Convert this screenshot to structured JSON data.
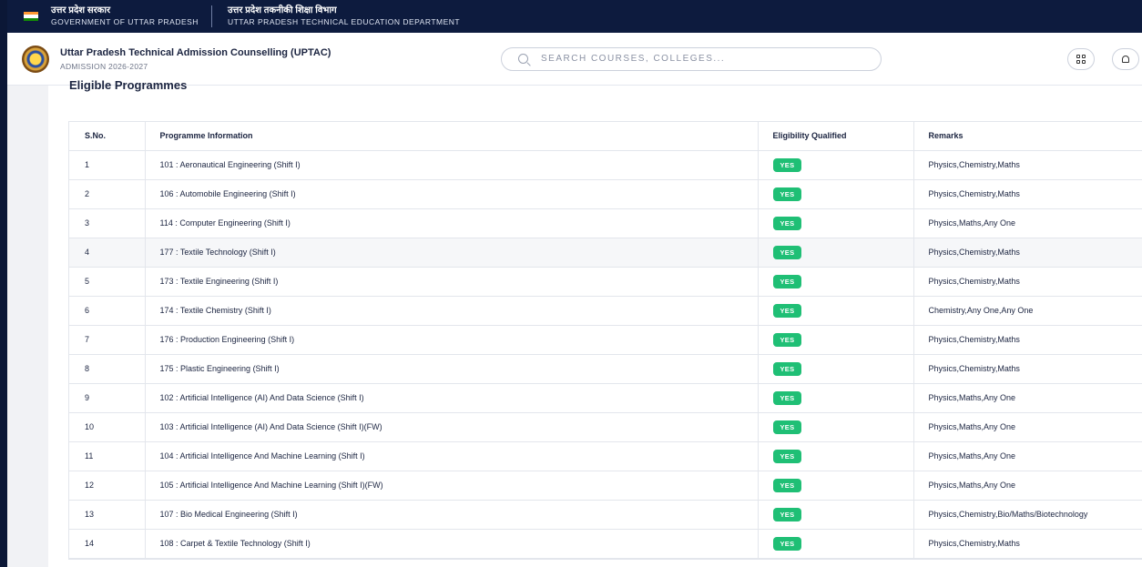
{
  "gov": {
    "hindi": "उत्तर प्रदेश सरकार",
    "english": "GOVERNMENT OF UTTAR PRADESH",
    "dept_hindi": "उत्तर प्रदेश तकनीकी शिक्षा विभाग",
    "dept_english": "UTTAR PRADESH TECHNICAL EDUCATION DEPARTMENT"
  },
  "header": {
    "title": "Uttar Pradesh Technical Admission Counselling (UPTAC)",
    "subtitle": "ADMISSION 2026-2027",
    "search_placeholder": "SEARCH COURSES, COLLEGES..."
  },
  "section": {
    "title": "Eligible Programmes"
  },
  "table": {
    "headers": [
      "S.No.",
      "Programme Information",
      "Eligibility Qualified",
      "Remarks"
    ],
    "rows": [
      {
        "sno": "1",
        "programme": "101 : Aeronautical Engineering (Shift I)",
        "eligible": "YES",
        "remarks": "Physics,Chemistry,Maths"
      },
      {
        "sno": "2",
        "programme": "106 : Automobile Engineering (Shift I)",
        "eligible": "YES",
        "remarks": "Physics,Chemistry,Maths"
      },
      {
        "sno": "3",
        "programme": "114 : Computer Engineering (Shift I)",
        "eligible": "YES",
        "remarks": "Physics,Maths,Any One"
      },
      {
        "sno": "4",
        "programme": "177 : Textile Technology (Shift I)",
        "eligible": "YES",
        "remarks": "Physics,Chemistry,Maths"
      },
      {
        "sno": "5",
        "programme": "173 : Textile Engineering (Shift I)",
        "eligible": "YES",
        "remarks": "Physics,Chemistry,Maths"
      },
      {
        "sno": "6",
        "programme": "174 : Textile Chemistry (Shift I)",
        "eligible": "YES",
        "remarks": "Chemistry,Any One,Any One"
      },
      {
        "sno": "7",
        "programme": "176 : Production Engineering (Shift I)",
        "eligible": "YES",
        "remarks": "Physics,Chemistry,Maths"
      },
      {
        "sno": "8",
        "programme": "175 : Plastic Engineering (Shift I)",
        "eligible": "YES",
        "remarks": "Physics,Chemistry,Maths"
      },
      {
        "sno": "9",
        "programme": "102 : Artificial Intelligence (AI) And Data Science (Shift I)",
        "eligible": "YES",
        "remarks": "Physics,Maths,Any One"
      },
      {
        "sno": "10",
        "programme": "103 : Artificial Intelligence (AI) And Data Science (Shift I)(FW)",
        "eligible": "YES",
        "remarks": "Physics,Maths,Any One"
      },
      {
        "sno": "11",
        "programme": "104 : Artificial Intelligence And Machine Learning (Shift I)",
        "eligible": "YES",
        "remarks": "Physics,Maths,Any One"
      },
      {
        "sno": "12",
        "programme": "105 : Artificial Intelligence And Machine Learning (Shift I)(FW)",
        "eligible": "YES",
        "remarks": "Physics,Maths,Any One"
      },
      {
        "sno": "13",
        "programme": "107 : Bio Medical Engineering (Shift I)",
        "eligible": "YES",
        "remarks": "Physics,Chemistry,Bio/Maths/Biotechnology"
      },
      {
        "sno": "14",
        "programme": "108 : Carpet & Textile Technology (Shift I)",
        "eligible": "YES",
        "remarks": "Physics,Chemistry,Maths"
      }
    ]
  },
  "colors": {
    "gov_bar": "#0d1b3e",
    "badge_green": "#1fbf75",
    "highlight_row": "#f6f7f9"
  }
}
